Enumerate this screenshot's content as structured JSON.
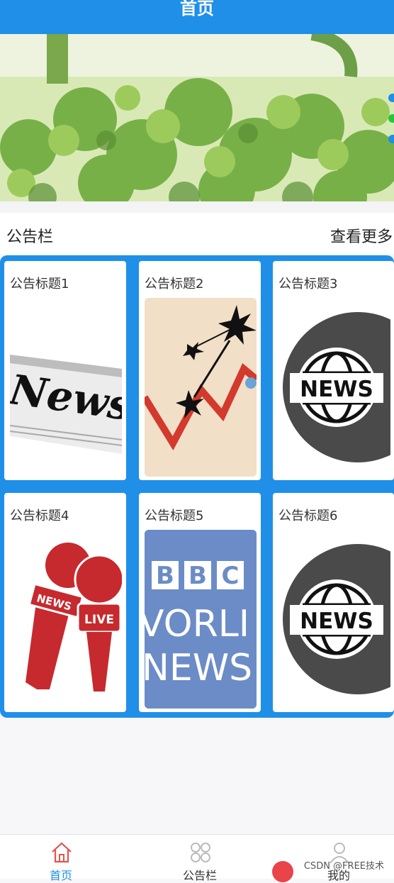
{
  "header": {
    "title": "首页"
  },
  "banner": {
    "dots": [
      "#1f8fe8",
      "#22c63a",
      "#1f8fe8"
    ]
  },
  "notice": {
    "section_title": "公告栏",
    "more_label": "查看更多",
    "cards": [
      {
        "title": "公告标题1",
        "image": "newspaper-news"
      },
      {
        "title": "公告标题2",
        "image": "chart-explosion"
      },
      {
        "title": "公告标题3",
        "image": "globe-news"
      },
      {
        "title": "公告标题4",
        "image": "microphones-live"
      },
      {
        "title": "公告标题5",
        "image": "bbc-world-news"
      },
      {
        "title": "公告标题6",
        "image": "globe-news"
      }
    ]
  },
  "tabbar": {
    "tabs": [
      {
        "label": "首页",
        "icon": "home-icon",
        "active": true
      },
      {
        "label": "公告栏",
        "icon": "grid-icon",
        "active": false
      },
      {
        "label": "我的",
        "icon": "user-icon",
        "active": false
      }
    ]
  },
  "watermark": "CSDN @FREE技术",
  "colors": {
    "primary": "#1f8fe8",
    "active_tab": "#e0564d"
  }
}
